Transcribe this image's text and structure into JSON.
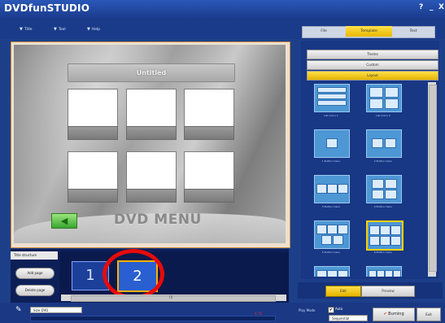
{
  "app": {
    "title": "DVDfunSTUDIO",
    "help": "?",
    "minimize": "_",
    "close": "X"
  },
  "menu": [
    {
      "arrow": "▼",
      "label": "Title"
    },
    {
      "arrow": "▼",
      "label": "Tool"
    },
    {
      "arrow": "▼",
      "label": "Help"
    }
  ],
  "tabs": {
    "file": "File",
    "template": "Template",
    "text": "Text"
  },
  "preview": {
    "title": "Untitled",
    "dvd_menu": "DVD MENU",
    "prev_arrow": "◀"
  },
  "right_panel": {
    "theme": "Theme",
    "custom": "Custom",
    "layout": "Layout",
    "layouts": [
      {
        "label": "List menu 1"
      },
      {
        "label": "List menu 2"
      },
      {
        "label": "1 Button menu"
      },
      {
        "label": "2 Button menu"
      },
      {
        "label": "3 Button menu"
      },
      {
        "label": "4 Button menu"
      },
      {
        "label": "5 Button menu"
      },
      {
        "label": "6 Button menu"
      }
    ],
    "edit": "Edit",
    "preview_btn": "Preview"
  },
  "structure": {
    "tab": "Title structure",
    "add_page": "Add page",
    "delete_page": "Delete page",
    "pages": [
      "1",
      "2"
    ],
    "scroll_mid": "III"
  },
  "status": {
    "disc_icon": "✎",
    "disc_type": "Size DVD",
    "capacity_marker": "4.7G",
    "play_mode": "Play Mode",
    "auto_check": "✔",
    "auto": "Auto",
    "sequential": "Sequential",
    "burning": "Burning",
    "exit": "Exit"
  }
}
